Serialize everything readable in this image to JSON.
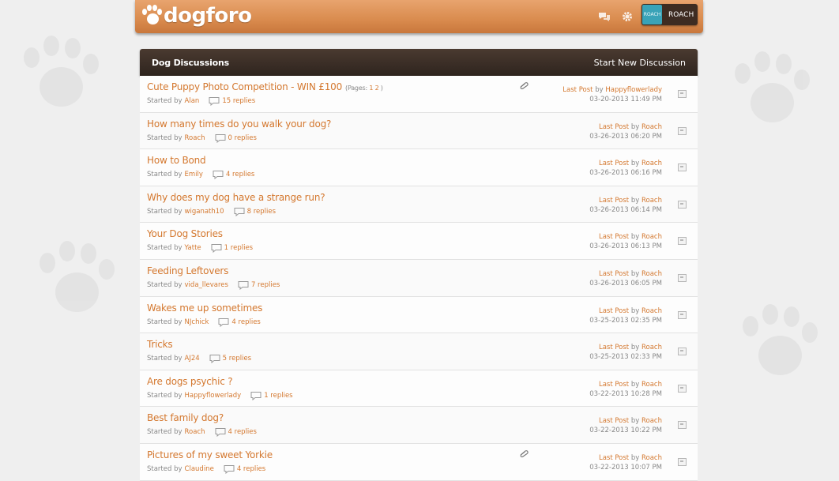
{
  "header": {
    "logo_text": "dogforo",
    "user_name": "ROACH",
    "avatar_text": "ROACH"
  },
  "panel": {
    "title": "Dog Discussions",
    "new_discussion_label": "Start New Discussion"
  },
  "labels": {
    "started_by": "Started by",
    "last_post": "Last Post",
    "by": "by",
    "replies_suffix": "replies"
  },
  "threads": [
    {
      "title": "Cute Puppy Photo Competition - WIN £100",
      "pages_prefix": "(Pages:",
      "page1": "1",
      "page2": "2",
      "pages_suffix": ")",
      "author": "Alan",
      "replies": "15 replies",
      "last_by": "Happyflowerlady",
      "last_date": "03-20-2013 11:49 PM",
      "attachment": true
    },
    {
      "title": "How many times do you walk your dog?",
      "author": "Roach",
      "replies": "0 replies",
      "last_by": "Roach",
      "last_date": "03-26-2013 06:20 PM",
      "attachment": false
    },
    {
      "title": "How to Bond",
      "author": "Emily",
      "replies": "4 replies",
      "last_by": "Roach",
      "last_date": "03-26-2013 06:16 PM",
      "attachment": false
    },
    {
      "title": "Why does my dog have a strange run?",
      "author": "wiganath10",
      "replies": "8 replies",
      "last_by": "Roach",
      "last_date": "03-26-2013 06:14 PM",
      "attachment": false
    },
    {
      "title": "Your Dog Stories",
      "author": "Yatte",
      "replies": "1 replies",
      "last_by": "Roach",
      "last_date": "03-26-2013 06:13 PM",
      "attachment": false
    },
    {
      "title": "Feeding Leftovers",
      "author": "vida_llevares",
      "replies": "7 replies",
      "last_by": "Roach",
      "last_date": "03-26-2013 06:05 PM",
      "attachment": false
    },
    {
      "title": "Wakes me up sometimes",
      "author": "NJchick",
      "replies": "4 replies",
      "last_by": "Roach",
      "last_date": "03-25-2013 02:35 PM",
      "attachment": false
    },
    {
      "title": "Tricks",
      "author": "AJ24",
      "replies": "5 replies",
      "last_by": "Roach",
      "last_date": "03-25-2013 02:33 PM",
      "attachment": false
    },
    {
      "title": "Are dogs psychic ?",
      "author": "Happyflowerlady",
      "replies": "1 replies",
      "last_by": "Roach",
      "last_date": "03-22-2013 10:28 PM",
      "attachment": false
    },
    {
      "title": "Best family dog?",
      "author": "Roach",
      "replies": "4 replies",
      "last_by": "Roach",
      "last_date": "03-22-2013 10:22 PM",
      "attachment": false
    },
    {
      "title": "Pictures of my sweet Yorkie",
      "author": "Claudine",
      "replies": "4 replies",
      "last_by": "Roach",
      "last_date": "03-22-2013 10:07 PM",
      "attachment": true
    }
  ]
}
